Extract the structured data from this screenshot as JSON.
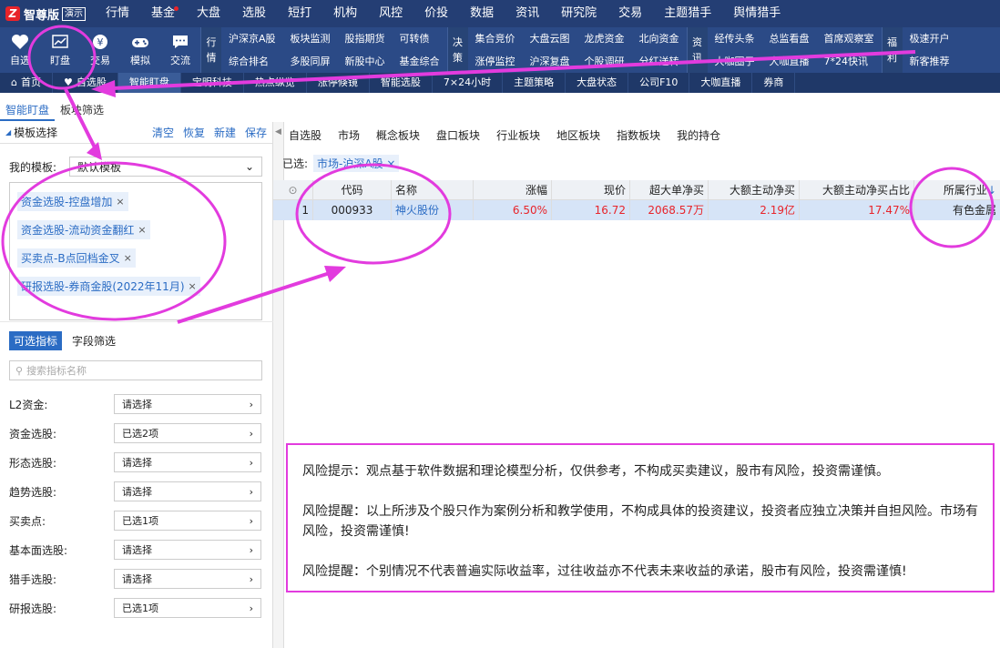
{
  "app": {
    "brand": "智尊版",
    "badge": "演示"
  },
  "top_menu": [
    "行情",
    "基金",
    "大盘",
    "选股",
    "短打",
    "机构",
    "风控",
    "价投",
    "数据",
    "资讯",
    "研究院",
    "交易",
    "主题猎手",
    "舆情猎手"
  ],
  "toolbar": {
    "buttons": [
      {
        "label": "自选",
        "icon": "heart-icon"
      },
      {
        "label": "盯盘",
        "icon": "chart-icon"
      },
      {
        "label": "交易",
        "icon": "yen-icon"
      },
      {
        "label": "模拟",
        "icon": "gamepad-icon"
      },
      {
        "label": "交流",
        "icon": "chat-icon"
      }
    ],
    "groups": [
      {
        "title": [
          "行",
          "情"
        ],
        "items": [
          "沪深京A股",
          "综合排名",
          "板块监测",
          "多股同屏",
          "股指期货",
          "新股中心",
          "可转债",
          "基金综合"
        ]
      },
      {
        "title": [
          "决",
          "策"
        ],
        "items": [
          "集合竞价",
          "涨停监控",
          "大盘云图",
          "沪深复盘",
          "龙虎资金",
          "个股调研",
          "北向资金",
          "分红送转"
        ]
      },
      {
        "title": [
          "资",
          "讯"
        ],
        "items": [
          "经传头条",
          "大咖圈子",
          "总监看盘",
          "大咖直播",
          "首席观察室",
          "7*24快讯"
        ]
      },
      {
        "title": [
          "福",
          "利"
        ],
        "items": [
          "极速开户",
          "新客推荐"
        ]
      }
    ]
  },
  "tab_bar": [
    "首页",
    "自选股",
    "智能盯盘",
    "宝明科技",
    "热点纵览",
    "涨停倏镜",
    "智能选股",
    "7×24小时",
    "主题策略",
    "大盘状态",
    "公司F10",
    "大咖直播",
    "券商"
  ],
  "tab_bar_active": "智能盯盘",
  "subtabs": [
    "智能盯盘",
    "板块筛选"
  ],
  "left": {
    "header": "模板选择",
    "actions": [
      "清空",
      "恢复",
      "新建",
      "保存"
    ],
    "my_template_label": "我的模板:",
    "my_template_value": "默认模板",
    "tags": [
      "资金选股-控盘增加",
      "资金选股-流动资金翻红",
      "买卖点-B点回档金叉",
      "研报选股-券商金股(2022年11月)"
    ],
    "indicator_tabs": [
      "可选指标",
      "字段筛选"
    ],
    "search_placeholder": "搜索指标名称",
    "filters": [
      {
        "label": "L2资金:",
        "value": "请选择"
      },
      {
        "label": "资金选股:",
        "value": "已选2项"
      },
      {
        "label": "形态选股:",
        "value": "请选择"
      },
      {
        "label": "趋势选股:",
        "value": "请选择"
      },
      {
        "label": "买卖点:",
        "value": "已选1项"
      },
      {
        "label": "基本面选股:",
        "value": "请选择"
      },
      {
        "label": "猎手选股:",
        "value": "请选择"
      },
      {
        "label": "研报选股:",
        "value": "已选1项"
      }
    ]
  },
  "right": {
    "category_tabs": [
      "自选股",
      "市场",
      "概念板块",
      "盘口板块",
      "行业板块",
      "地区板块",
      "指数板块",
      "我的持仓"
    ],
    "selected_label": "已选:",
    "selected_value": "市场-沪深A股",
    "columns": [
      "代码",
      "名称",
      "涨幅",
      "现价",
      "超大单净买",
      "大额主动净买",
      "大额主动净买占比",
      "所属行业"
    ],
    "rows": [
      {
        "index": "1",
        "code": "000933",
        "name": "神火股份",
        "change": "6.50%",
        "price": "16.72",
        "super_net": "2068.57万",
        "large_net": "2.19亿",
        "large_ratio": "17.47%",
        "industry": "有色金属"
      }
    ]
  },
  "risk": [
    "风险提示：观点基于软件数据和理论模型分析，仅供参考，不构成买卖建议，股市有风险，投资需谨慎。",
    "风险提醒：以上所涉及个股只作为案例分析和教学使用，不构成具体的投资建议，投资者应独立决策并自担风险。市场有风险，投资需谨慎!",
    "风险提醒：个别情况不代表普遍实际收益率，过往收益亦不代表未来收益的承诺，股市有风险，投资需谨慎!"
  ],
  "colors": {
    "accent": "#2b6cc4",
    "annotation": "#e23bde",
    "up": "#e8242a",
    "topbar": "#243e74"
  }
}
